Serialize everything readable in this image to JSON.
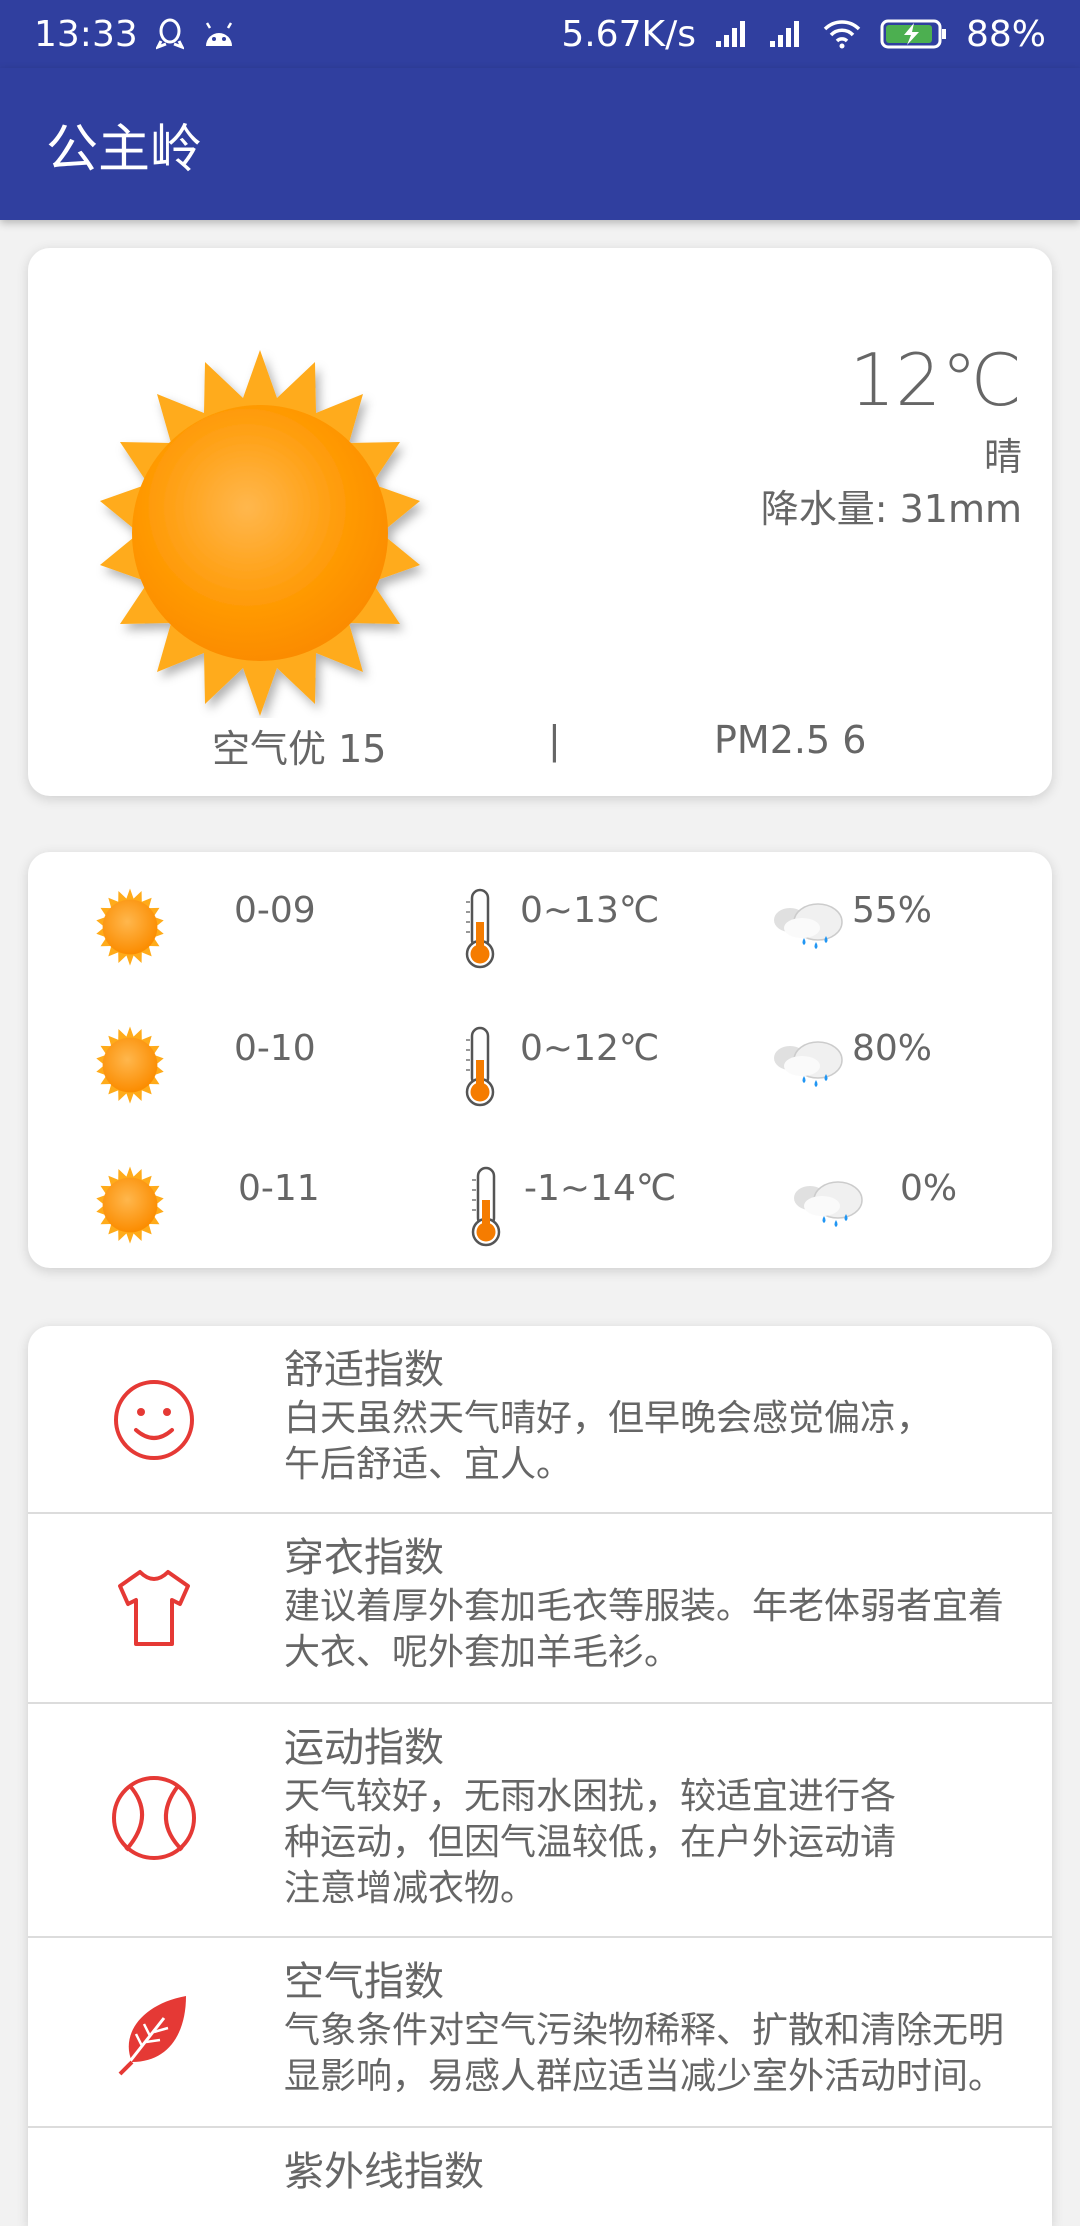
{
  "status_bar": {
    "time": "13:33",
    "net_speed": "5.67K/s",
    "battery": "88%"
  },
  "app_bar": {
    "title": "公主岭"
  },
  "current": {
    "temperature": "12℃",
    "condition": "晴",
    "precipitation": "降水量: 31mm",
    "aqi": "空气优  15",
    "separator": "|",
    "pm25": "PM2.5  6"
  },
  "forecast": [
    {
      "date": "0-09",
      "temp_range": "0~13℃",
      "humidity": "55%"
    },
    {
      "date": "0-10",
      "temp_range": "0~12℃",
      "humidity": "80%"
    },
    {
      "date": "0-11",
      "temp_range": "-1~14℃",
      "humidity": "0%"
    }
  ],
  "indices": [
    {
      "icon": "smiley-icon",
      "title": "舒适指数",
      "desc": "白天虽然天气晴好，但早晚会感觉偏凉，\n午后舒适、宜人。"
    },
    {
      "icon": "tshirt-icon",
      "title": "穿衣指数",
      "desc": "建议着厚外套加毛衣等服装。年老体弱者宜着\n大衣、呢外套加羊毛衫。"
    },
    {
      "icon": "ball-icon",
      "title": "运动指数",
      "desc": "天气较好，无雨水困扰，较适宜进行各\n种运动，但因气温较低，在户外运动请\n注意增减衣物。"
    },
    {
      "icon": "leaf-icon",
      "title": "空气指数",
      "desc": "气象条件对空气污染物稀释、扩散和清除无明\n显影响，易感人群应适当减少室外活动时间。"
    },
    {
      "icon": "uv-icon",
      "title": "紫外线指数",
      "desc": ""
    }
  ],
  "colors": {
    "primary": "#303f9f",
    "sun": "#ffa000",
    "index_icon": "#e53935"
  }
}
